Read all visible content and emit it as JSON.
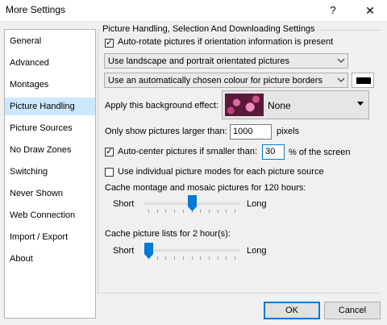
{
  "window": {
    "title": "More Settings",
    "help": "?",
    "close": "✕"
  },
  "sidebar": {
    "items": [
      {
        "label": "General"
      },
      {
        "label": "Advanced"
      },
      {
        "label": "Montages"
      },
      {
        "label": "Picture Handling",
        "selected": true
      },
      {
        "label": "Picture Sources"
      },
      {
        "label": "No Draw Zones"
      },
      {
        "label": "Switching"
      },
      {
        "label": "Never Shown"
      },
      {
        "label": "Web Connection"
      },
      {
        "label": "Import / Export"
      },
      {
        "label": "About"
      }
    ]
  },
  "group": {
    "title": "Picture Handling, Selection And Downloading Settings"
  },
  "settings": {
    "auto_rotate": {
      "label": "Auto-rotate pictures if orientation information is present",
      "checked": true
    },
    "orientation_combo": {
      "value": "Use landscape and portrait orientated pictures"
    },
    "border_combo": {
      "value": "Use an automatically chosen colour for picture borders"
    },
    "border_color": "#000000",
    "background_effect": {
      "label": "Apply this background effect:",
      "value": "None"
    },
    "min_size": {
      "label": "Only show pictures larger than:",
      "value": "1000",
      "unit": "pixels"
    },
    "auto_center": {
      "label": "Auto-center pictures if smaller than:",
      "checked": true,
      "value": "30",
      "unit": "% of the screen"
    },
    "individual_modes": {
      "label": "Use individual picture modes for each picture source",
      "checked": false
    },
    "montage_cache": {
      "label": "Cache montage and mosaic pictures for 120 hours:",
      "min_label": "Short",
      "max_label": "Long",
      "level": 0.5
    },
    "list_cache": {
      "label": "Cache picture lists for 2 hour(s):",
      "min_label": "Short",
      "max_label": "Long",
      "level": 0.0
    }
  },
  "buttons": {
    "ok": "OK",
    "cancel": "Cancel"
  },
  "colors": {
    "selection": "#cce8ff",
    "accent": "#0078d7",
    "slider_thumb": "#0078d7"
  }
}
